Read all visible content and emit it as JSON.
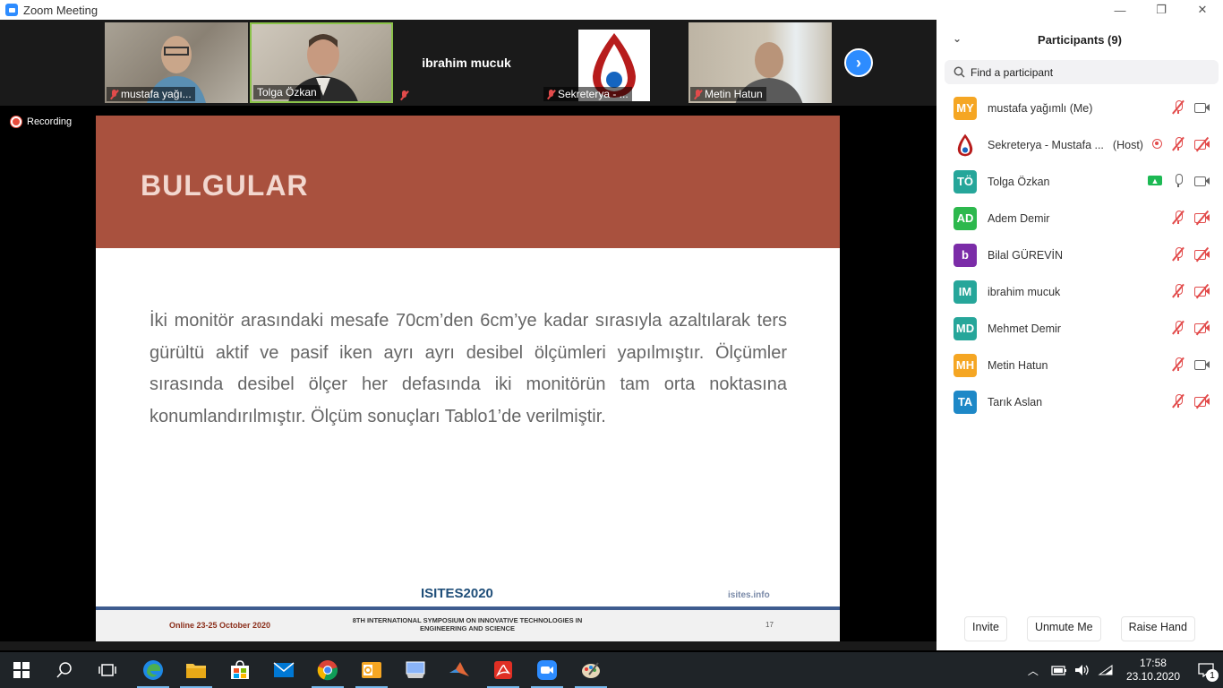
{
  "window": {
    "title": "Zoom Meeting",
    "minimize": "—",
    "restore": "❐",
    "close": "✕"
  },
  "strip": {
    "tiles": [
      {
        "name": "mustafa yağı...",
        "muted": true
      },
      {
        "name": "Tolga Özkan",
        "muted": false
      },
      {
        "name": "ibrahim mucuk",
        "muted": true
      },
      {
        "name": "Sekreterya - ...",
        "muted": true
      },
      {
        "name": "Metin Hatun",
        "muted": true
      }
    ],
    "next": "›"
  },
  "recording": "Recording",
  "slide": {
    "title": "BULGULAR",
    "body": "İki monitör arasındaki mesafe 70cm’den 6cm’ye kadar sırasıyla azaltılarak ters gürültü aktif ve pasif iken ayrı ayrı desibel ölçümleri yapılmıştır. Ölçümler sırasında desibel ölçer her defasında iki monitörün tam orta noktasına konumlandırılmıştır. Ölçüm sonuçları Tablo1’de verilmiştir.",
    "brand": "ISITES2020",
    "url": "isites.info",
    "footer_date": "Online 23-25 October 2020",
    "footer_event_line1": "8TH INTERNATIONAL SYMPOSIUM ON INNOVATIVE TECHNOLOGIES IN",
    "footer_event_line2": "ENGINEERING AND SCIENCE",
    "page": "17"
  },
  "panel": {
    "title": "Participants (9)",
    "search_placeholder": "Find a participant",
    "participants": [
      {
        "initials": "MY",
        "name": "mustafa yağımlı (Me)",
        "tag": "",
        "color": "#f5a623",
        "mic": "off",
        "cam": "on"
      },
      {
        "initials": "",
        "name": "Sekreterya - Mustafa ...",
        "tag": "(Host)",
        "color": "#b71c1c",
        "mic": "off",
        "cam": "off"
      },
      {
        "initials": "TÖ",
        "name": "Tolga Özkan",
        "tag": "",
        "color": "#26a69a",
        "mic": "on",
        "cam": "on"
      },
      {
        "initials": "AD",
        "name": "Adem Demir",
        "tag": "",
        "color": "#2db84d",
        "mic": "off",
        "cam": "off"
      },
      {
        "initials": "b",
        "name": "Bilal GÜREVİN",
        "tag": "",
        "color": "#7b2ca8",
        "mic": "off",
        "cam": "off"
      },
      {
        "initials": "IM",
        "name": "ibrahim mucuk",
        "tag": "",
        "color": "#26a69a",
        "mic": "off",
        "cam": "off"
      },
      {
        "initials": "MD",
        "name": "Mehmet Demir",
        "tag": "",
        "color": "#26a69a",
        "mic": "off",
        "cam": "off"
      },
      {
        "initials": "MH",
        "name": "Metin Hatun",
        "tag": "",
        "color": "#f5a623",
        "mic": "off",
        "cam": "on"
      },
      {
        "initials": "TA",
        "name": "Tarık Aslan",
        "tag": "",
        "color": "#1e88c7",
        "mic": "off",
        "cam": "off"
      }
    ],
    "buttons": {
      "invite": "Invite",
      "unmute": "Unmute Me",
      "raise": "Raise Hand"
    }
  },
  "taskbar": {
    "time": "17:58",
    "date": "23.10.2020",
    "notifications": "1"
  }
}
